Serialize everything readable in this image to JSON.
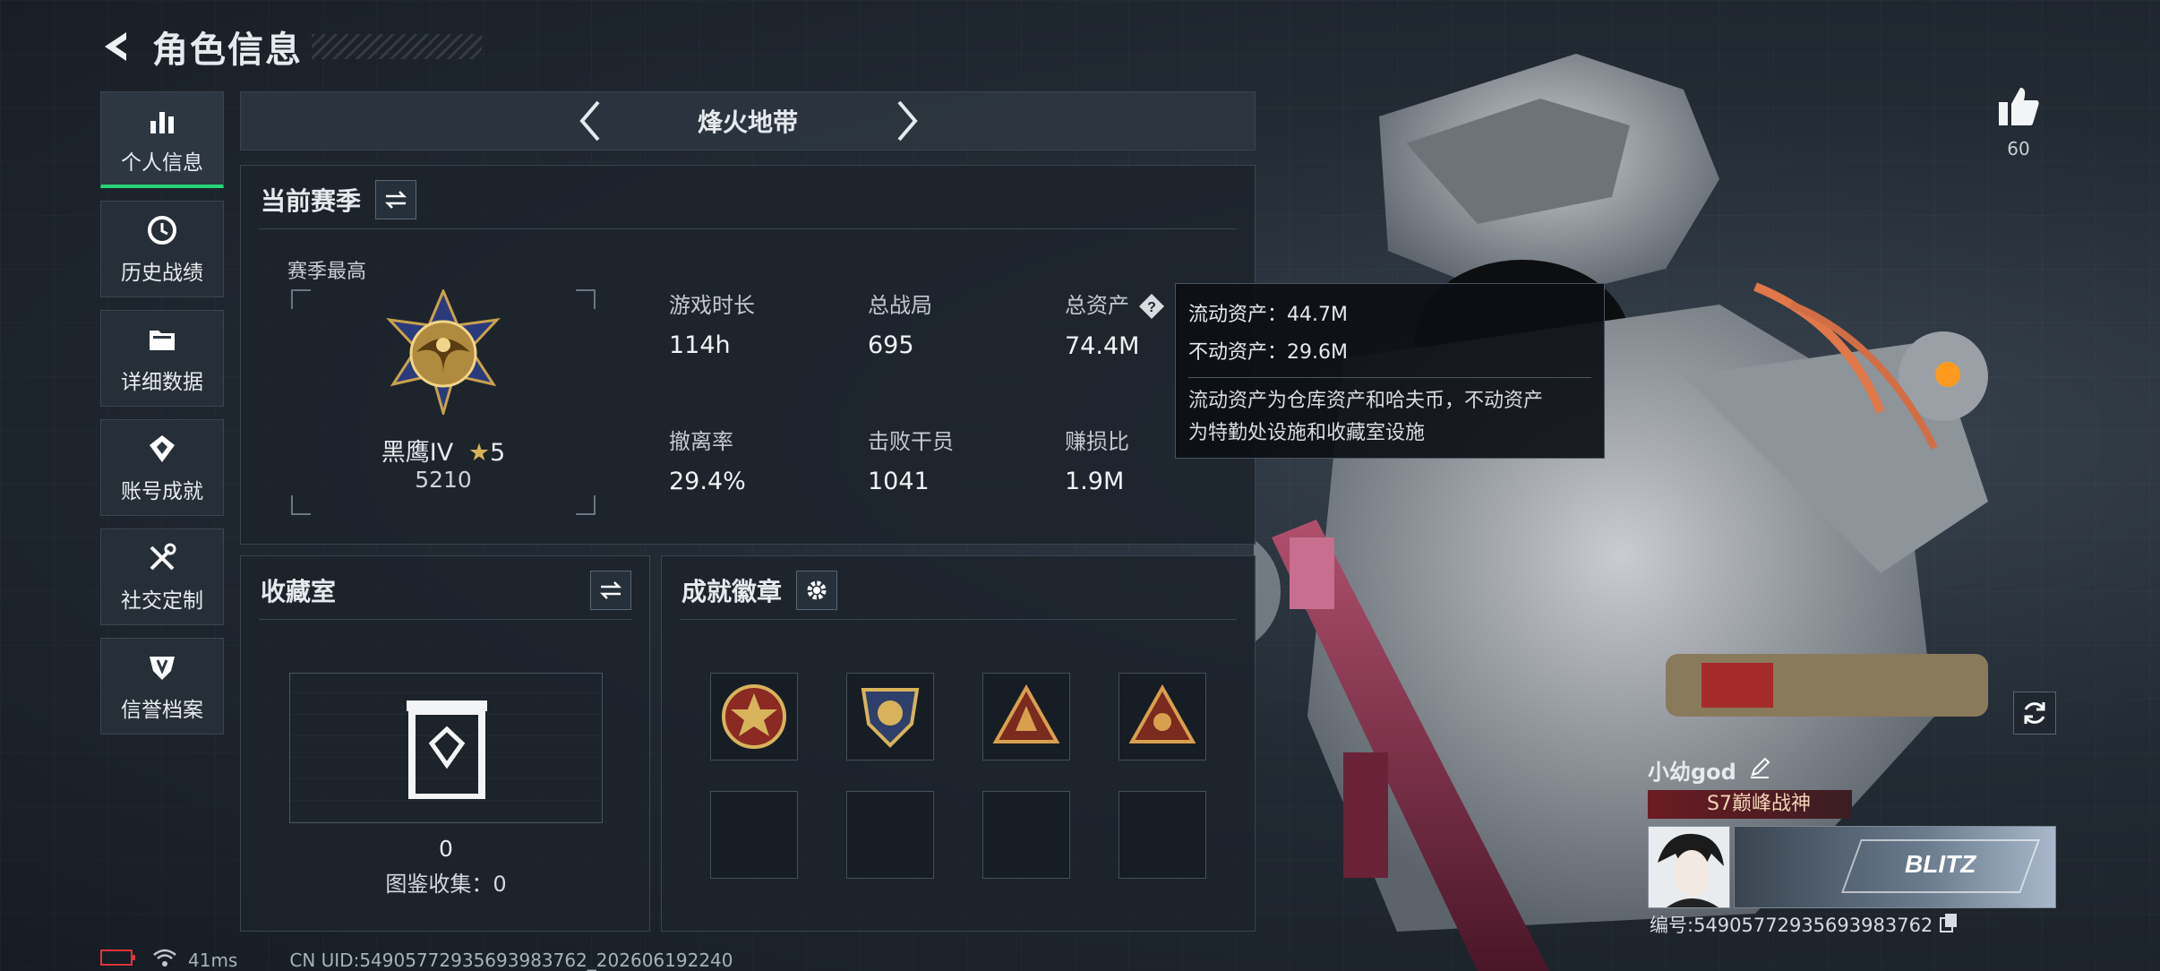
{
  "header": {
    "title": "角色信息"
  },
  "nav": {
    "items": [
      {
        "label": "个人信息",
        "icon": "bar-chart-icon",
        "active": true
      },
      {
        "label": "历史战绩",
        "icon": "history-icon"
      },
      {
        "label": "详细数据",
        "icon": "folder-icon"
      },
      {
        "label": "账号成就",
        "icon": "achievement-icon"
      },
      {
        "label": "社交定制",
        "icon": "tools-icon"
      },
      {
        "label": "信誉档案",
        "icon": "shield-icon"
      }
    ]
  },
  "mode": {
    "title": "烽火地带"
  },
  "season": {
    "title": "当前赛季",
    "best_label": "赛季最高",
    "rank_name": "黑鹰IV",
    "rank_stars": "5",
    "rank_score": "5210",
    "stats": [
      {
        "label": "游戏时长",
        "value": "114h"
      },
      {
        "label": "总战局",
        "value": "695"
      },
      {
        "label": "总资产",
        "value": "74.4M"
      },
      {
        "label": "撤离率",
        "value": "29.4%"
      },
      {
        "label": "击败干员",
        "value": "1041"
      },
      {
        "label": "赚损比",
        "value": "1.9M"
      }
    ]
  },
  "tooltip": {
    "liquid": "流动资产：44.7M",
    "fixed": "不动资产：29.6M",
    "note_line1": "流动资产为仓库资产和哈夫币，不动资产",
    "note_line2": "为特勤处设施和收藏室设施"
  },
  "collection": {
    "title": "收藏室",
    "count": "0",
    "catalog": "图鉴收集：0"
  },
  "badges": {
    "title": "成就徽章"
  },
  "like": {
    "count": "60"
  },
  "player": {
    "name": "小幼god",
    "title": "S7巅峰战神",
    "nameplate_text": "BLITZ",
    "id": "编号:549057729356939837​62"
  },
  "footer": {
    "ping": "41ms",
    "uid": "CN UID:549057729356939837​62_202606192240"
  },
  "colors": {
    "accent": "#27d477",
    "panel": "#1c232b"
  }
}
